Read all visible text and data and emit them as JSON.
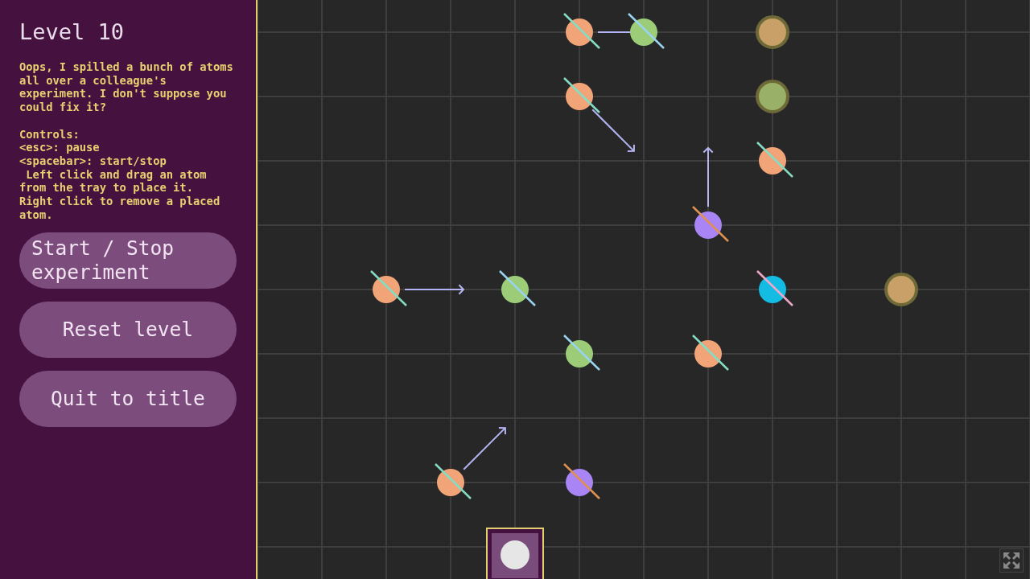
{
  "sidebar": {
    "title": "Level 10",
    "instructions": "Oops, I spilled a bunch of atoms all over a colleague's experiment. I don't suppose you could fix it?\n\nControls:\n<esc>: pause\n<spacebar>: start/stop\n Left click and drag an atom from the tray to place it.\nRight click to remove a placed atom.",
    "buttons": [
      "Start / Stop experiment",
      "Reset level",
      "Quit to title"
    ]
  },
  "board": {
    "atoms": [
      {
        "kind": "atom",
        "color": "#f0a478"
      },
      {
        "kind": "atom",
        "color": "#9ccc78"
      },
      {
        "kind": "target",
        "color": "#c8a068"
      },
      {
        "kind": "atom",
        "color": "#f0a478"
      },
      {
        "kind": "target",
        "color": "#98b068"
      },
      {
        "kind": "atom",
        "color": "#f0a478"
      },
      {
        "kind": "atom",
        "color": "#a884f4"
      },
      {
        "kind": "atom",
        "color": "#f0a478"
      },
      {
        "kind": "atom",
        "color": "#9ccc78"
      },
      {
        "kind": "atom",
        "color": "#14bce4"
      },
      {
        "kind": "target",
        "color": "#c8a068"
      },
      {
        "kind": "atom",
        "color": "#9ccc78"
      },
      {
        "kind": "atom",
        "color": "#f0a478"
      },
      {
        "kind": "atom",
        "color": "#f0a478"
      },
      {
        "kind": "atom",
        "color": "#a884f4"
      }
    ],
    "tray": {
      "color": "#e6e6e6"
    }
  }
}
